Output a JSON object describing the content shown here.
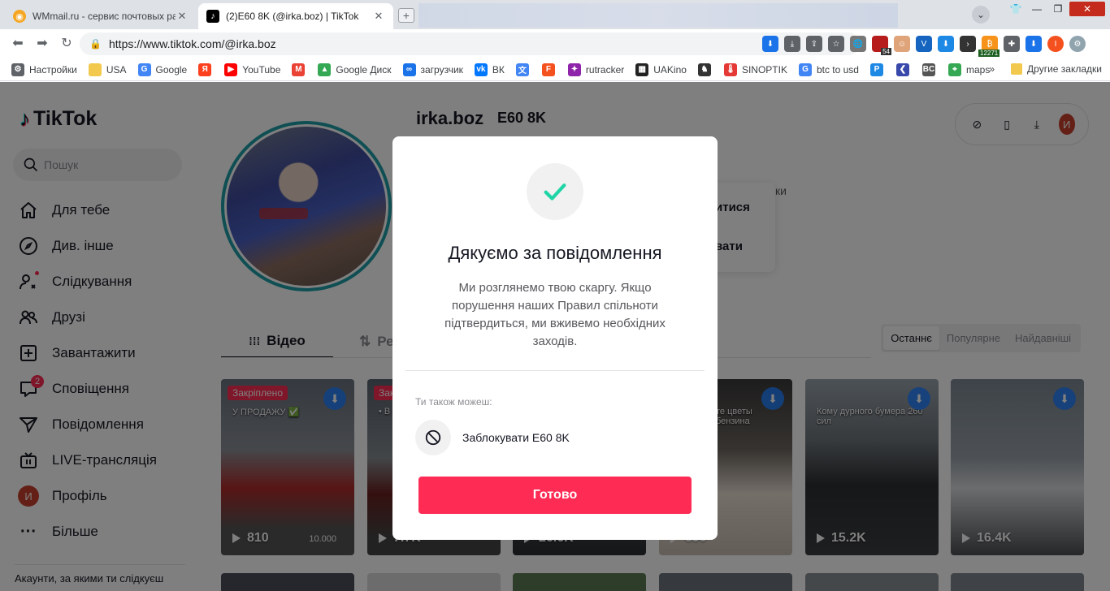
{
  "browser": {
    "tabs": [
      {
        "title": "WMmail.ru - сервис почтовых рас",
        "active": false
      },
      {
        "title": "(2)E60 8K (@irka.boz) | TikTok",
        "active": true
      }
    ],
    "profile_letter": "I",
    "url": "https://www.tiktok.com/@irka.boz",
    "ext_badges": {
      "count_a": "54",
      "count_b": "12271"
    },
    "bookmarks": [
      {
        "label": "Настройки",
        "icon": "gear-icon",
        "color": "#5f6368"
      },
      {
        "label": "USA",
        "icon": "folder-icon",
        "color": "#f2c94c"
      },
      {
        "label": "Google",
        "icon": "google-icon",
        "color": "#4285f4"
      },
      {
        "label": "",
        "icon": "yandex-icon",
        "color": "#fc3f1d"
      },
      {
        "label": "YouTube",
        "icon": "youtube-icon",
        "color": "#ff0000"
      },
      {
        "label": "",
        "icon": "gmail-icon",
        "color": "#ea4335"
      },
      {
        "label": "Google Диск",
        "icon": "drive-icon",
        "color": "#34a853"
      },
      {
        "label": "загрузчик",
        "icon": "link-icon",
        "color": "#1a73e8"
      },
      {
        "label": "ВК",
        "icon": "vk-icon",
        "color": "#0077ff"
      },
      {
        "label": "",
        "icon": "translate-icon",
        "color": "#4285f4"
      },
      {
        "label": "",
        "icon": "f-icon",
        "color": "#f4511e"
      },
      {
        "label": "rutracker",
        "icon": "star-icon",
        "color": "#8e24aa"
      },
      {
        "label": "UAKino",
        "icon": "film-icon",
        "color": "#222222"
      },
      {
        "label": "",
        "icon": "chess-icon",
        "color": "#333333"
      },
      {
        "label": "SINOPTIK",
        "icon": "thermo-icon",
        "color": "#e53935"
      },
      {
        "label": "btc to usd",
        "icon": "google-icon",
        "color": "#4285f4"
      },
      {
        "label": "",
        "icon": "p-icon",
        "color": "#1e88e5"
      },
      {
        "label": "",
        "icon": "arrow-icon",
        "color": "#3949ab"
      },
      {
        "label": "",
        "icon": "bc-icon",
        "color": "#555555"
      },
      {
        "label": "maps",
        "icon": "maps-icon",
        "color": "#34a853"
      }
    ],
    "more_bookmarks": "»",
    "other_bookmarks": "Другие закладки"
  },
  "sidebar": {
    "logo": "TikTok",
    "search_placeholder": "Пошук",
    "items": [
      {
        "label": "Для тебе",
        "icon": "home-icon"
      },
      {
        "label": "Див. інше",
        "icon": "compass-icon"
      },
      {
        "label": "Слідкування",
        "icon": "following-icon"
      },
      {
        "label": "Друзі",
        "icon": "friends-icon"
      },
      {
        "label": "Завантажити",
        "icon": "upload-icon"
      },
      {
        "label": "Сповіщення",
        "icon": "inbox-icon",
        "badge": "2"
      },
      {
        "label": "Повідомлення",
        "icon": "send-icon"
      },
      {
        "label": "LIVE-трансляція",
        "icon": "live-icon"
      },
      {
        "label": "Профіль",
        "icon": "avatar-icon",
        "avatar_letter": "И"
      },
      {
        "label": "Більше",
        "icon": "more-icon"
      }
    ],
    "following_caption": "Акаунти, за якими ти слідкуєш"
  },
  "profile": {
    "username": "irka.boz",
    "nickname": "E60 8K",
    "bg_menu": [
      "итися",
      "вати"
    ],
    "bg_fragment": "ки",
    "tabs": {
      "videos": "Відео",
      "reposts": "Ре"
    },
    "sort": [
      "Останнє",
      "Популярне",
      "Найдавніші"
    ],
    "avatar_letter": "И"
  },
  "videos": [
    {
      "views": "810",
      "pinned": "Закріплено",
      "caption": "У ПРОДАЖУ ✅",
      "extra": "10.000"
    },
    {
      "views": "7.7K",
      "pinned": "Закр",
      "caption": "• В",
      "extra": ""
    },
    {
      "views": "26.6K",
      "pinned": "",
      "caption": "",
      "extra": ""
    },
    {
      "views": "890",
      "pinned": "",
      "caption": "те цветы бензина",
      "extra": ""
    },
    {
      "views": "15.2K",
      "pinned": "",
      "caption": "Кому дурного бумера 260 сил",
      "extra": ""
    },
    {
      "views": "16.4K",
      "pinned": "",
      "caption": "",
      "extra": ""
    }
  ],
  "modal": {
    "title": "Дякуємо за повідомлення",
    "body": "Ми розглянемо твою скаргу. Якщо порушення наших Правил спільноти підтвердиться, ми вживемо необхідних заходів.",
    "also_label": "Ти також можеш:",
    "block_label": "Заблокувати E60 8K",
    "done_label": "Готово"
  },
  "colors": {
    "accent": "#fe2c55",
    "check": "#20d5a5",
    "ring": "#1e9fa8"
  }
}
